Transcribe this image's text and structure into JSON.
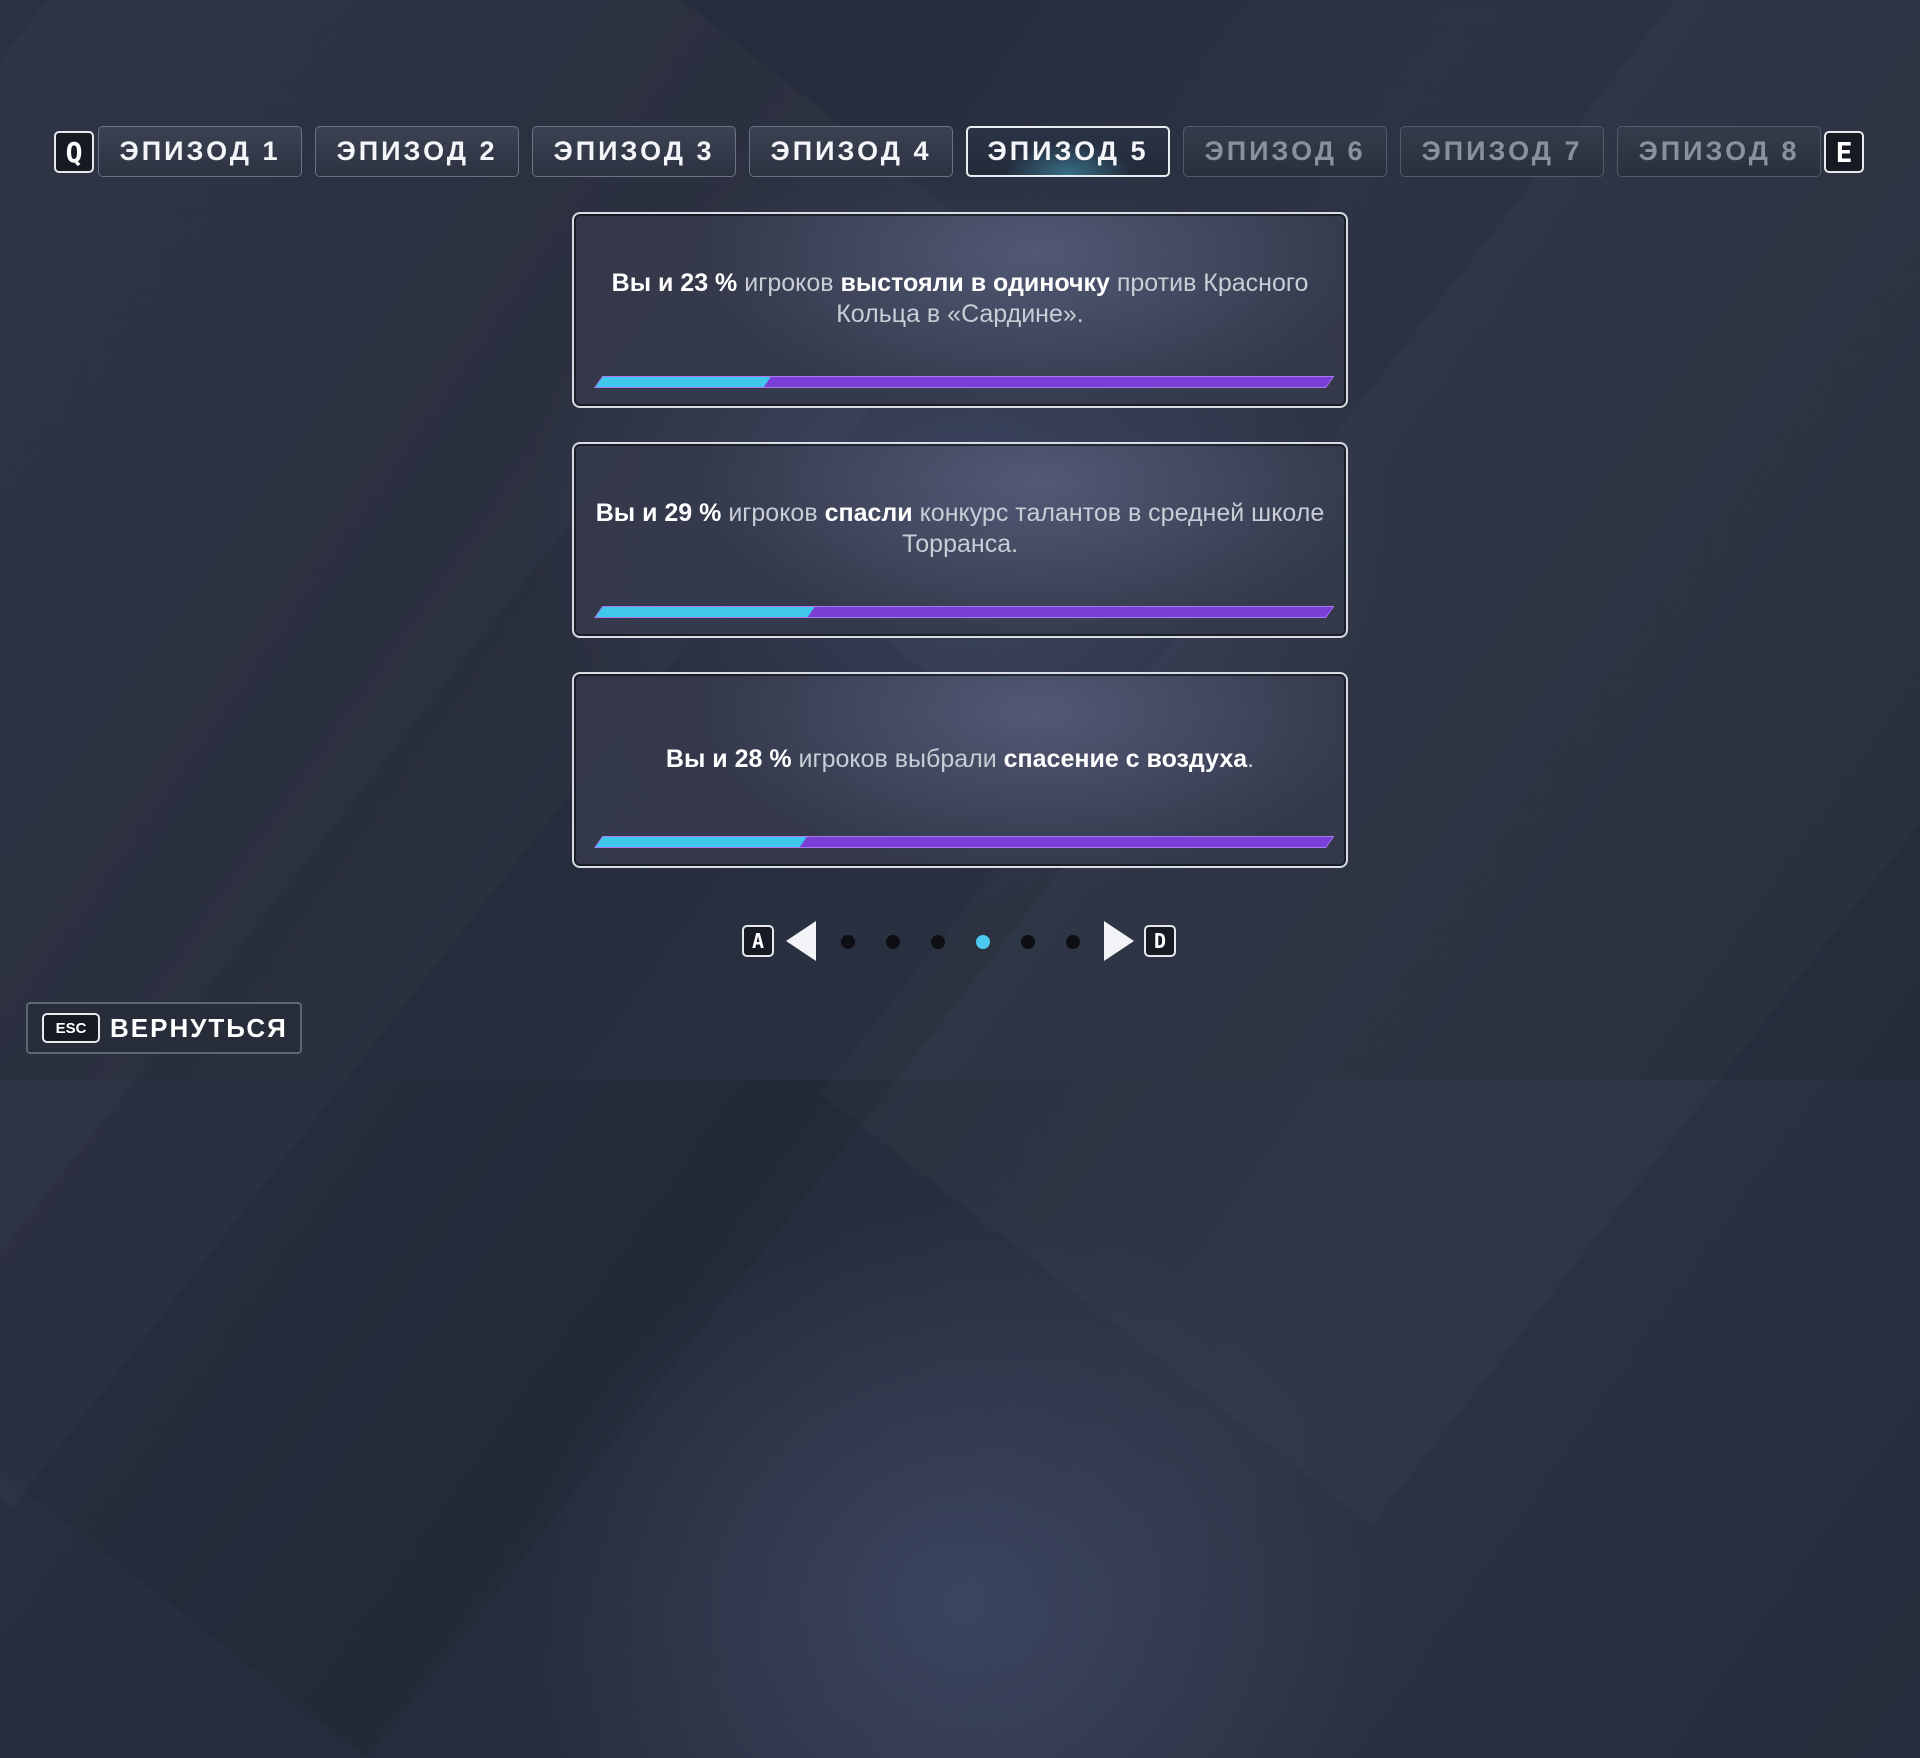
{
  "keys": {
    "prev_episode": "Q",
    "next_episode": "E",
    "prev_page": "A",
    "next_page": "D",
    "escape": "ESC"
  },
  "tabs": [
    {
      "label": "ЭПИЗОД 1",
      "state": "normal"
    },
    {
      "label": "ЭПИЗОД 2",
      "state": "normal"
    },
    {
      "label": "ЭПИЗОД 3",
      "state": "normal"
    },
    {
      "label": "ЭПИЗОД 4",
      "state": "normal"
    },
    {
      "label": "ЭПИЗОД 5",
      "state": "active"
    },
    {
      "label": "ЭПИЗОД 6",
      "state": "locked"
    },
    {
      "label": "ЭПИЗОД 7",
      "state": "locked"
    },
    {
      "label": "ЭПИЗОД 8",
      "state": "locked"
    }
  ],
  "cards": [
    {
      "parts": [
        {
          "text": "Вы и 23 %",
          "bold": true
        },
        {
          "text": " игроков ",
          "bold": false
        },
        {
          "text": "выстояли в одиночку",
          "bold": true
        },
        {
          "text": " против Красного Кольца в «Сардине».",
          "bold": false
        }
      ],
      "percent": 23
    },
    {
      "parts": [
        {
          "text": "Вы и 29 %",
          "bold": true
        },
        {
          "text": " игроков ",
          "bold": false
        },
        {
          "text": "спасли",
          "bold": true
        },
        {
          "text": " конкурс талантов в средней школе Торранса.",
          "bold": false
        }
      ],
      "percent": 29
    },
    {
      "parts": [
        {
          "text": "Вы и 28 %",
          "bold": true
        },
        {
          "text": " игроков выбрали ",
          "bold": false
        },
        {
          "text": "спасение с воздуха",
          "bold": true
        },
        {
          "text": ".",
          "bold": false
        }
      ],
      "percent": 28
    }
  ],
  "pagination": {
    "total": 6,
    "current_index": 3
  },
  "back_button": {
    "label": "ВЕРНУТЬСЯ"
  },
  "colors": {
    "bar_fill": "#3fc7ec",
    "bar_track": "#7a3fd6",
    "active_dot": "#4dc9ef"
  }
}
